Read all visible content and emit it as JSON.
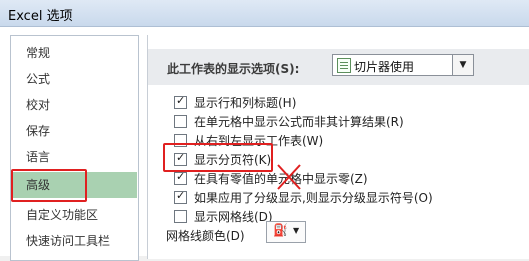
{
  "window": {
    "title": "Excel 选项"
  },
  "sidebar": {
    "items": [
      {
        "label": "常规"
      },
      {
        "label": "公式"
      },
      {
        "label": "校对"
      },
      {
        "label": "保存"
      },
      {
        "label": "语言"
      },
      {
        "label": "高级",
        "active": true
      },
      {
        "label": "自定义功能区"
      },
      {
        "label": "快速访问工具栏"
      }
    ]
  },
  "section": {
    "label": "此工作表的显示选项(S):",
    "sheet_select": {
      "value": "切片器使用"
    }
  },
  "options": [
    {
      "label": "显示行和列标题(H)",
      "checked": true
    },
    {
      "label": "在单元格中显示公式而非其计算结果(R)",
      "checked": false
    },
    {
      "label": "从右到左显示工作表(W)",
      "checked": false
    },
    {
      "label": "显示分页符(K)",
      "checked": true
    },
    {
      "label": "在具有零值的单元格中显示零(Z)",
      "checked": true
    },
    {
      "label": "如果应用了分级显示,则显示分级显示符号(O)",
      "checked": true
    },
    {
      "label": "显示网格线(D)",
      "checked": false
    }
  ],
  "gridline_color": {
    "label": "网格线颜色(D)",
    "icon": "paint-bucket-icon"
  },
  "annotations": {
    "highlight_color": "#e02020",
    "sidebar_active_color": "#a9d1b1"
  }
}
